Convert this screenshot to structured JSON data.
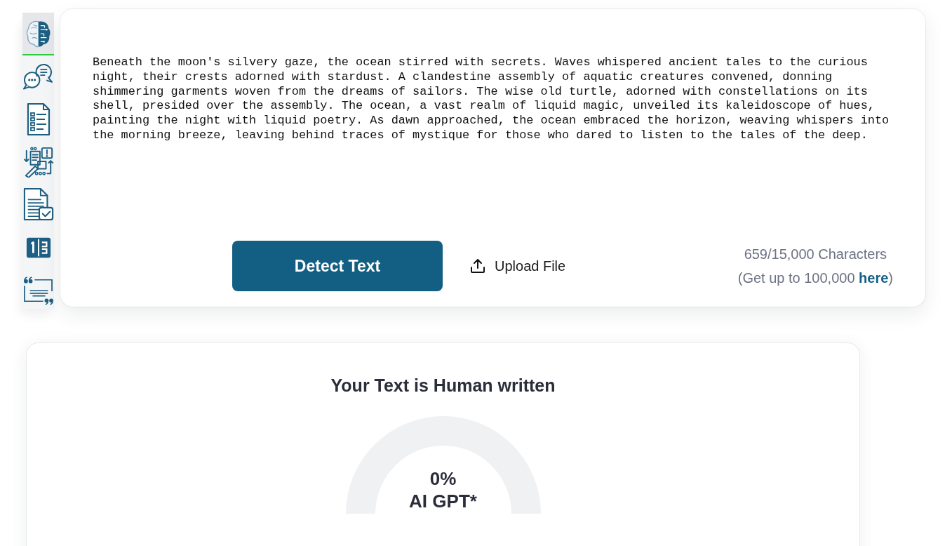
{
  "sidebar": {
    "items": [
      {
        "selected": true
      },
      {
        "selected": false
      },
      {
        "selected": false
      },
      {
        "selected": false
      },
      {
        "selected": false
      },
      {
        "selected": false
      },
      {
        "selected": false
      }
    ]
  },
  "editor": {
    "text": "Beneath the moon's silvery gaze, the ocean stirred with secrets. Waves whispered ancient tales to the curious night, their crests adorned with stardust. A clandestine assembly of aquatic creatures convened, donning shimmering garments woven from the dreams of sailors. The wise old turtle, adorned with constellations on its shell, presided over the assembly. The ocean, a vast realm of liquid magic, unveiled its kaleidoscope of hues, painting the night with liquid poetry. As dawn approached, the ocean embraced the horizon, weaving whispers into the morning breeze, leaving behind traces of mystique for those who dared to listen to the tales of the deep.",
    "detect_button": "Detect Text",
    "upload_button": "Upload File",
    "character_count": "659/15,000 Characters",
    "upgrade_note": {
      "before": "(Get up to 100,000 ",
      "link": "here",
      "after": ")"
    }
  },
  "result": {
    "title": "Your Text is Human written",
    "gauge": {
      "percent": "0%",
      "label": "AI GPT*"
    }
  }
}
